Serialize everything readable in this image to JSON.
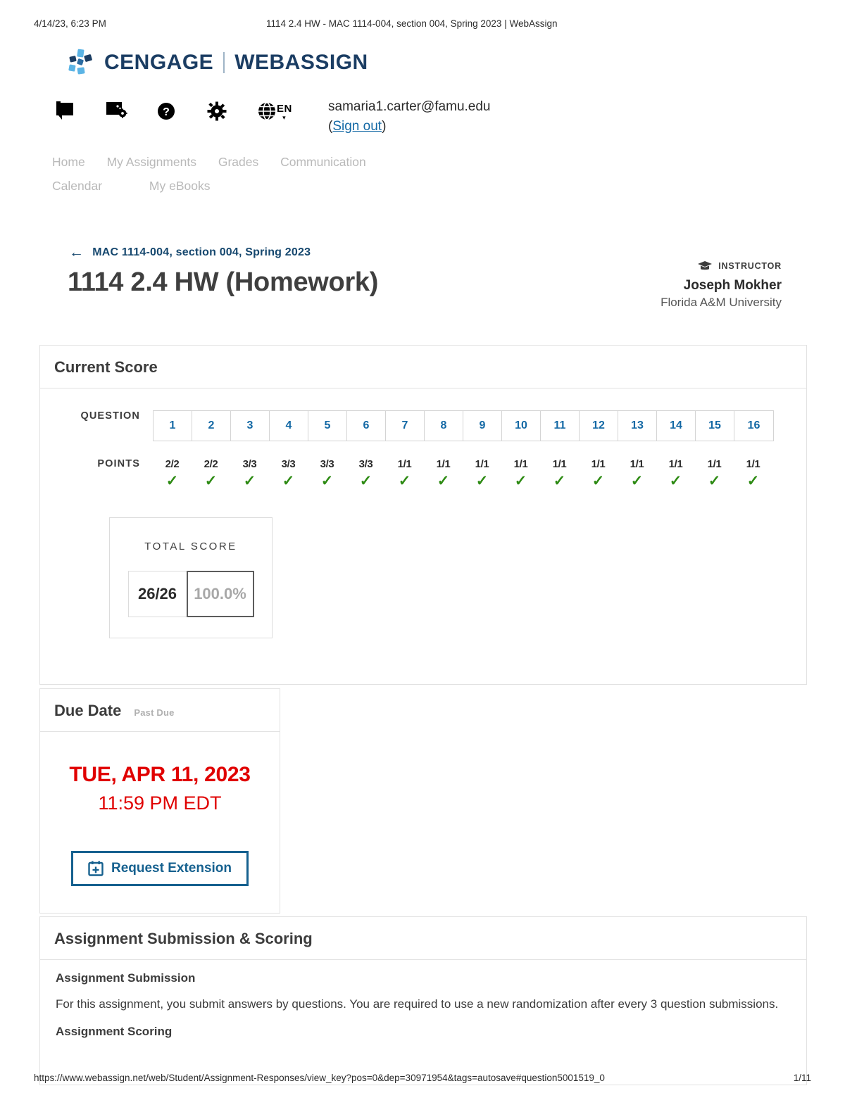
{
  "print_header": {
    "timestamp": "4/14/23, 6:23 PM",
    "doc_title": "1114 2.4 HW - MAC 1114-004, section 004, Spring 2023 | WebAssign"
  },
  "brand": {
    "cengage": "CENGAGE",
    "webassign": "WEBASSIGN",
    "logo_icon": "cengage-squares-icon",
    "color_dark": "#1b3d63",
    "color_light": "#5bb4e5"
  },
  "toolbar": {
    "icons": [
      {
        "name": "flag-icon",
        "label": "Flag"
      },
      {
        "name": "notes-settings-icon",
        "label": "Notes settings"
      },
      {
        "name": "help-circle-icon",
        "label": "Help"
      },
      {
        "name": "gear-icon",
        "label": "Settings"
      },
      {
        "name": "globe-icon",
        "label": "Language"
      }
    ],
    "language_code": "EN",
    "chevron": "▾"
  },
  "account": {
    "email": "samaria1.carter@famu.edu",
    "sign_out_open": "(",
    "sign_out": "Sign out",
    "sign_out_close": ")"
  },
  "nav": {
    "items": [
      {
        "label": "Home"
      },
      {
        "label": "My Assignments"
      },
      {
        "label": "Grades"
      },
      {
        "label": "Communication"
      },
      {
        "label": "Calendar"
      },
      {
        "label": "My eBooks"
      }
    ]
  },
  "breadcrumb": {
    "arrow": "←",
    "label": "MAC 1114-004, section 004, Spring 2023"
  },
  "page_title": "1114 2.4 HW (Homework)",
  "instructor": {
    "icon": "graduation-cap-icon",
    "label": "INSTRUCTOR",
    "name": "Joseph Mokher",
    "school": "Florida A&M University"
  },
  "current_score": {
    "heading": "Current Score",
    "question_row_label": "QUESTION",
    "points_row_label": "POINTS",
    "check_glyph": "✓",
    "check_color": "#2e8b14",
    "questions": [
      {
        "number": "1",
        "points": "2/2",
        "correct": true
      },
      {
        "number": "2",
        "points": "2/2",
        "correct": true
      },
      {
        "number": "3",
        "points": "3/3",
        "correct": true
      },
      {
        "number": "4",
        "points": "3/3",
        "correct": true
      },
      {
        "number": "5",
        "points": "3/3",
        "correct": true
      },
      {
        "number": "6",
        "points": "3/3",
        "correct": true
      },
      {
        "number": "7",
        "points": "1/1",
        "correct": true
      },
      {
        "number": "8",
        "points": "1/1",
        "correct": true
      },
      {
        "number": "9",
        "points": "1/1",
        "correct": true
      },
      {
        "number": "10",
        "points": "1/1",
        "correct": true
      },
      {
        "number": "11",
        "points": "1/1",
        "correct": true
      },
      {
        "number": "12",
        "points": "1/1",
        "correct": true
      },
      {
        "number": "13",
        "points": "1/1",
        "correct": true
      },
      {
        "number": "14",
        "points": "1/1",
        "correct": true
      },
      {
        "number": "15",
        "points": "1/1",
        "correct": true
      },
      {
        "number": "16",
        "points": "1/1",
        "correct": true
      }
    ],
    "total": {
      "label": "TOTAL SCORE",
      "fraction": "26/26",
      "percent": "100.0%"
    }
  },
  "due_date": {
    "heading": "Due Date",
    "status": "Past Due",
    "date": "TUE, APR 11, 2023",
    "time": "11:59 PM EDT",
    "button_label": "Request Extension",
    "button_icon": "calendar-plus-icon",
    "accent_color": "#e00000",
    "button_color": "#16618f"
  },
  "submission": {
    "heading": "Assignment Submission & Scoring",
    "sub1_heading": "Assignment Submission",
    "sub1_text": "For this assignment, you submit answers by questions. You are required to use a new randomization after every 3 question submissions.",
    "sub2_heading": "Assignment Scoring"
  },
  "footer": {
    "url": "https://www.webassign.net/web/Student/Assignment-Responses/view_key?pos=0&dep=30971954&tags=autosave#question5001519_0",
    "page": "1/11"
  }
}
